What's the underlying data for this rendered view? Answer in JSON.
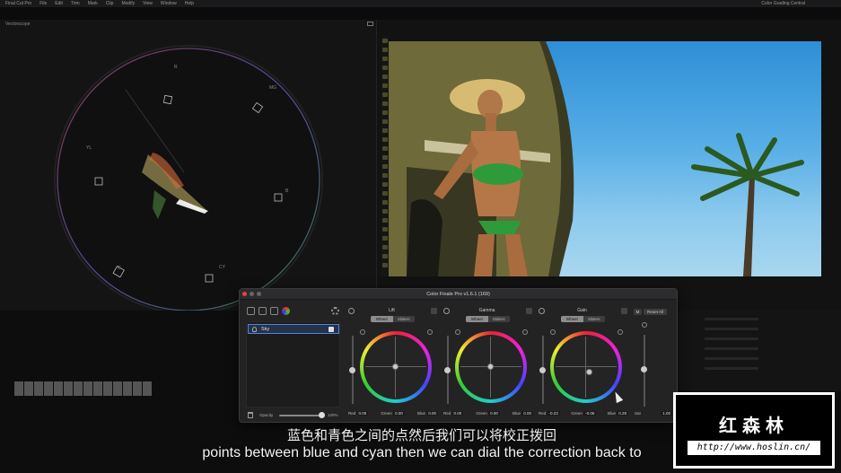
{
  "menubar": {
    "items": [
      "Final Cut Pro",
      "File",
      "Edit",
      "Trim",
      "Mark",
      "Clip",
      "Modify",
      "View",
      "Window",
      "Help"
    ],
    "right_text": "Color Grading Central"
  },
  "scope": {
    "title": "Vectorscope",
    "labels": {
      "R": "R",
      "MG": "MG",
      "B": "B",
      "CY": "CY",
      "G": "G",
      "YL": "YL"
    }
  },
  "panel": {
    "title": "Color Finale Pro v1.6.1 (169)",
    "layer_name": "Sky",
    "opacity_label": "Opacity",
    "opacity_value": "100%",
    "opacity_level": 1.0,
    "wheels": [
      {
        "name": "Lift",
        "seg": [
          "Wheel",
          "Sliders"
        ],
        "red_label": "Red",
        "red": "0.00",
        "green_label": "Green",
        "green": "0.00",
        "blue_label": "Blue",
        "blue": "0.00"
      },
      {
        "name": "Gamma",
        "seg": [
          "Wheel",
          "Sliders"
        ],
        "red_label": "Red",
        "red": "0.00",
        "green_label": "Green",
        "green": "0.00",
        "blue_label": "Blue",
        "blue": "0.00"
      },
      {
        "name": "Gain",
        "seg": [
          "Wheel",
          "Sliders"
        ],
        "red_label": "Red",
        "red": "-0.23",
        "green_label": "Green",
        "green": "-0.06",
        "blue_label": "Blue",
        "blue": "0.29"
      }
    ],
    "m_button": "M",
    "reset_all": "Reset All",
    "sat_label": "Sat",
    "sat_value": "1.00"
  },
  "subtitles": {
    "chinese": "蓝色和青色之间的点然后我们可以将校正拨回",
    "english": "points between blue and cyan then we can dial the correction back to"
  },
  "watermark": {
    "name": "红森林",
    "url": "http://www.hoslin.cn/"
  },
  "colors": {
    "accent_blue": "#4f86d6",
    "panel_bg": "#232324",
    "close_red": "#e0443e"
  }
}
